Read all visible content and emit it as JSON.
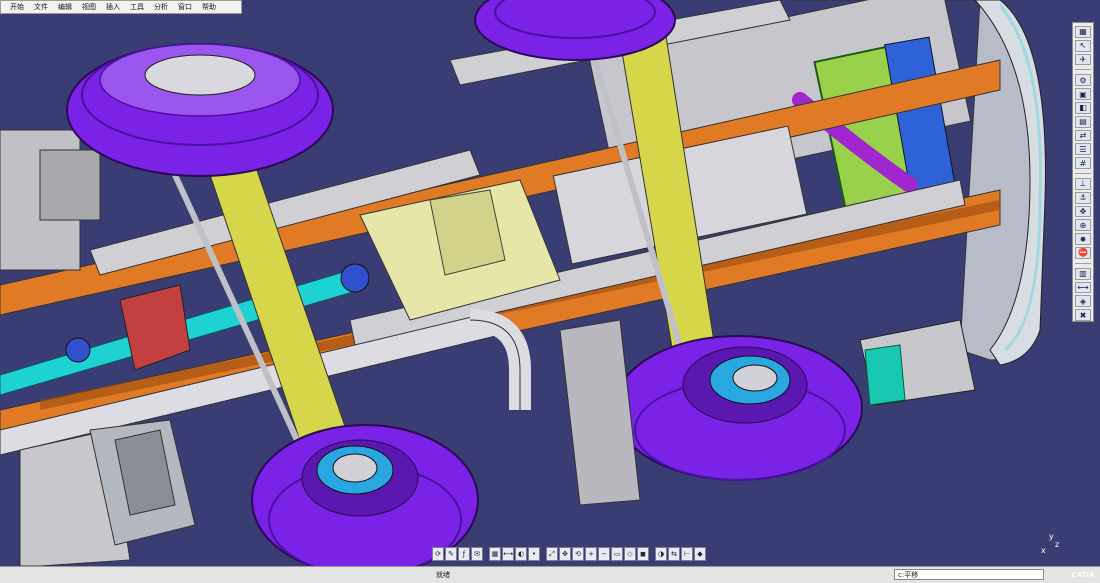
{
  "menu": {
    "items": [
      "开始",
      "文件",
      "编辑",
      "视图",
      "插入",
      "工具",
      "分析",
      "窗口",
      "帮助"
    ]
  },
  "right_toolbar": {
    "icons": [
      "product-structure-icon",
      "select-icon",
      "fly-mode-icon",
      "component-icon",
      "new-product-icon",
      "new-part-icon",
      "existing-component-icon",
      "replace-icon",
      "graph-tree-icon",
      "generate-numbering-icon",
      "constraint-icon",
      "fix-icon",
      "manipulation-icon",
      "snap-icon",
      "explode-icon",
      "stop-clash-icon",
      "bill-of-material-icon",
      "measure-icon",
      "scenes-icon",
      "clash-icon"
    ]
  },
  "bottom_toolbar": {
    "icons": [
      "update-icon",
      "sketch-icon",
      "fx-formula-icon",
      "comment-icon",
      "table-icon",
      "measure-icon",
      "analysis-icon",
      "point-icon",
      "fit-all-icon",
      "pan-icon",
      "rotate-icon",
      "zoom-in-icon",
      "zoom-out-icon",
      "normal-view-icon",
      "iso-view-icon",
      "render-style-icon",
      "hide-show-icon",
      "swap-space-icon",
      "axis-icon",
      "material-icon"
    ]
  },
  "status": {
    "text": "就绪",
    "command_value": "c:平移"
  },
  "compass": {
    "x": "x",
    "y": "y",
    "z": "z"
  },
  "brand": {
    "logo": "CATIA"
  },
  "colors": {
    "background": "#3a3d73",
    "tire": "#7a22e6",
    "axle": "#d6d64a",
    "frame": "#e07a24",
    "driveshaft": "#1ed2d2",
    "frame_grey": "#c8c8cc"
  }
}
